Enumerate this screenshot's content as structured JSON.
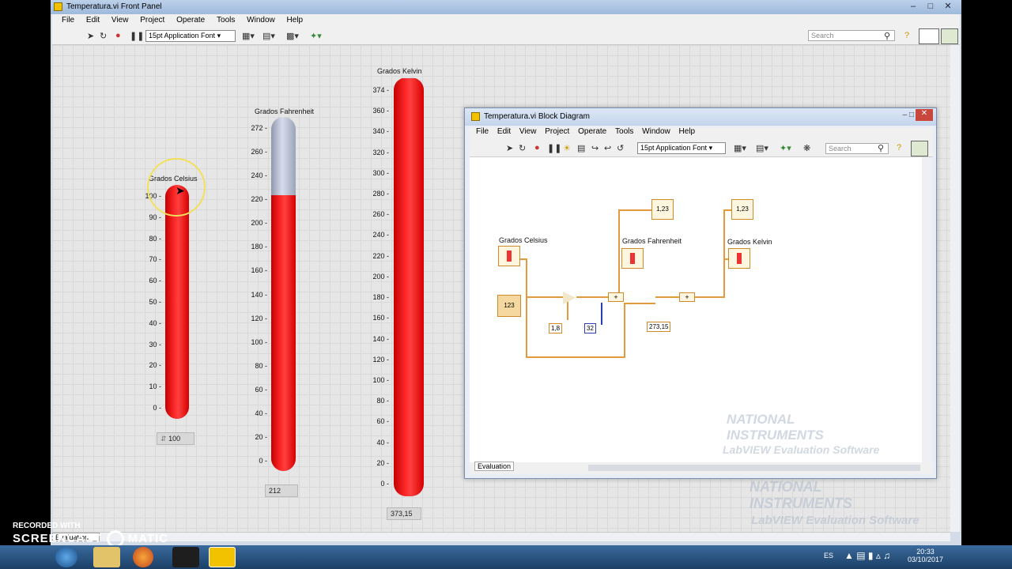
{
  "window": {
    "title": "Temperatura.vi Front Panel"
  },
  "menu": [
    "File",
    "Edit",
    "View",
    "Project",
    "Operate",
    "Tools",
    "Window",
    "Help"
  ],
  "toolbar": {
    "font": "15pt Application Font",
    "search_placeholder": "Search"
  },
  "celsius": {
    "label": "Grados Celsius",
    "ticks": [
      "100",
      "90",
      "80",
      "70",
      "60",
      "50",
      "40",
      "30",
      "20",
      "10",
      "0"
    ],
    "value": "100",
    "level": 1.0
  },
  "fahrenheit": {
    "label": "Grados Fahrenheit",
    "ticks": [
      "272",
      "260",
      "240",
      "220",
      "200",
      "180",
      "160",
      "140",
      "120",
      "100",
      "80",
      "60",
      "40",
      "20",
      "0"
    ],
    "value": "212",
    "level": 0.779
  },
  "kelvin": {
    "label": "Grados Kelvin",
    "ticks": [
      "374",
      "360",
      "340",
      "320",
      "300",
      "280",
      "260",
      "240",
      "220",
      "200",
      "180",
      "160",
      "140",
      "120",
      "100",
      "80",
      "60",
      "40",
      "20",
      "0"
    ],
    "value": "373,15",
    "level": 0.998
  },
  "block_diagram": {
    "title": "Temperatura.vi Block Diagram",
    "menu": [
      "File",
      "Edit",
      "View",
      "Project",
      "Operate",
      "Tools",
      "Window",
      "Help"
    ],
    "font": "15pt Application Font",
    "search_placeholder": "Search",
    "labels": {
      "celsius": "Grados Celsius",
      "fahrenheit": "Grados Fahrenheit",
      "kelvin": "Grados Kelvin"
    },
    "constants": {
      "mult": "1,8",
      "add_f": "32",
      "add_k": "273,15"
    },
    "numeric_icon": "1,23",
    "control_icon": "123",
    "status": "Evaluation"
  },
  "watermark": {
    "line1": "NATIONAL",
    "line2": "INSTRUMENTS",
    "line3": "LabVIEW Evaluation Software"
  },
  "recorded": {
    "line1": "RECORDED WITH",
    "line2": "SCREENCAST",
    "line3": "MATIC"
  },
  "status": "Evaluation",
  "tray": {
    "lang": "ES",
    "time": "20:33",
    "date": "03/10/2017"
  },
  "colors": {
    "mercury": "#ff2020",
    "glass": "#c3c9d8",
    "wire_orange": "#e39a3c",
    "wire_blue": "#2a3fb5"
  }
}
